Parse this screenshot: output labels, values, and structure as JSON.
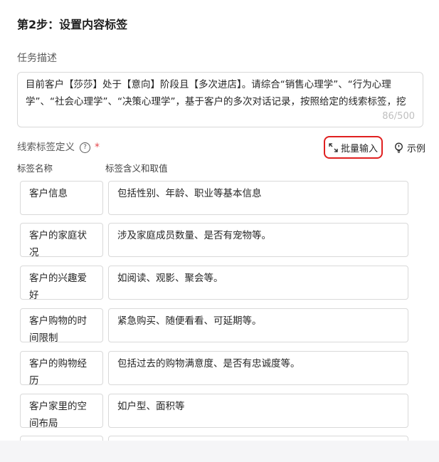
{
  "step_title": "第2步：设置内容标签",
  "task_description": {
    "label": "任务描述",
    "value": "目前客户【莎莎】处于【意向】阶段且【多次进店】。请综合“销售心理学”、“行为心理学”、“社会心理学”、“决策心理学”，基于客户的多次对话记录，按照给定的线索标签，挖",
    "char_count": "86/500"
  },
  "tag_definitions": {
    "label": "线索标签定义",
    "help_icon": "question-circle-icon",
    "required_mark": "*",
    "batch_button_label": "批量输入",
    "batch_button_icon": "expand-icon",
    "example_button_label": "示例",
    "example_button_icon": "lightbulb-icon",
    "highlight_color": "#e02020"
  },
  "columns": {
    "name": "标签名称",
    "meaning": "标签含义和取值"
  },
  "rows": [
    {
      "name": "客户信息",
      "meaning": "包括性别、年龄、职业等基本信息"
    },
    {
      "name": "客户的家庭状况",
      "meaning": "涉及家庭成员数量、是否有宠物等。"
    },
    {
      "name": "客户的兴趣爱好",
      "meaning": "如阅读、观影、聚会等。"
    },
    {
      "name": "客户购物的时间限制",
      "meaning": "紧急购买、随便看看、可延期等。"
    },
    {
      "name": "客户的购物经历",
      "meaning": "包括过去的购物满意度、是否有忠诚度等。"
    },
    {
      "name": "客户家里的空间布局",
      "meaning": "如户型、面积等"
    },
    {
      "name": "",
      "meaning": ""
    }
  ]
}
